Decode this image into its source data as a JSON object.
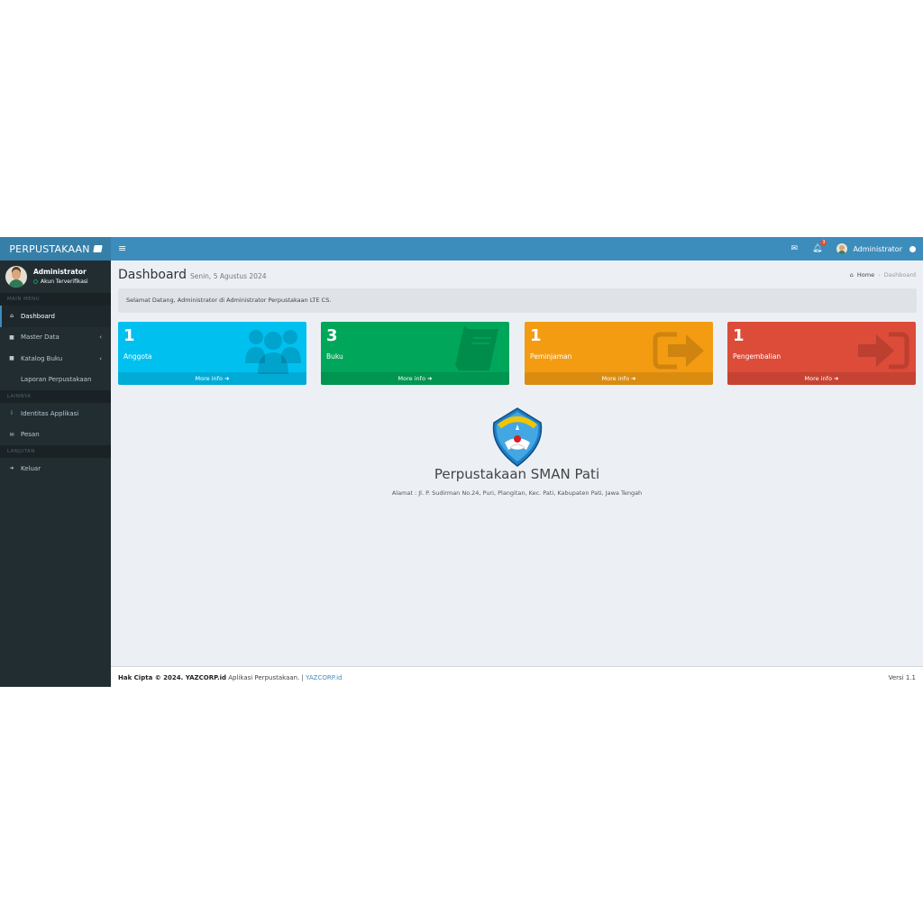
{
  "header": {
    "brand": "PERPUSTAKAAN",
    "toggle_glyph": "≡",
    "notification_count": "3",
    "user_name": "Administrator"
  },
  "sidebar": {
    "user": {
      "name": "Administrator",
      "status": "Akun Terverifikasi"
    },
    "sections": [
      {
        "header": "MAIN MENU",
        "items": [
          {
            "label": "Dashboard",
            "icon": "home-icon",
            "glyph": "⌂",
            "active": true
          },
          {
            "label": "Master Data",
            "icon": "folder-icon",
            "glyph": "■",
            "caret": true
          },
          {
            "label": "Katalog Buku",
            "icon": "folder-icon",
            "glyph": "■",
            "caret": true
          },
          {
            "label": "Laporan Perpustakaan",
            "icon": "file-icon",
            "glyph": ""
          }
        ]
      },
      {
        "header": "LAINNYA",
        "items": [
          {
            "label": "Identitas Applikasi",
            "icon": "info-icon",
            "glyph": "i"
          },
          {
            "label": "Pesan",
            "icon": "envelope-icon",
            "glyph": "✉"
          }
        ]
      },
      {
        "header": "LANJUTAN",
        "items": [
          {
            "label": "Keluar",
            "icon": "sign-out-icon",
            "glyph": "➜"
          }
        ]
      }
    ]
  },
  "page": {
    "title": "Dashboard",
    "subtitle": "Senin, 5 Agustus 2024",
    "breadcrumb": {
      "home": "Home",
      "current": "Dashboard"
    },
    "welcome": "Selamat Datang, Administrator di Administrator Perpustakaan LTE CS."
  },
  "stats": [
    {
      "count": "1",
      "label": "Anggota",
      "more": "More info",
      "color": "#00c0ef",
      "icon": "users-icon"
    },
    {
      "count": "3",
      "label": "Buku",
      "more": "More info",
      "color": "#00a65a",
      "icon": "book-icon"
    },
    {
      "count": "1",
      "label": "Peminjaman",
      "more": "More info",
      "color": "#f39c12",
      "icon": "share-icon"
    },
    {
      "count": "1",
      "label": "Pengembalian",
      "more": "More info",
      "color": "#dd4b39",
      "icon": "sign-in-icon"
    }
  ],
  "school": {
    "name": "Perpustakaan SMAN Pati",
    "address": "Alamat : Jl. P. Sudirman No.24, Puri, Plangitan, Kec. Pati, Kabupaten Pati, Jawa Tengah",
    "logo_text": "TUT WURI HANDAYANI"
  },
  "footer": {
    "copyright": "Hak Cipta © 2024. YAZCORP.id",
    "app": "Aplikasi Perpustakaan. |",
    "link": "YAZCORP.id",
    "version": "Versi 1.1"
  }
}
